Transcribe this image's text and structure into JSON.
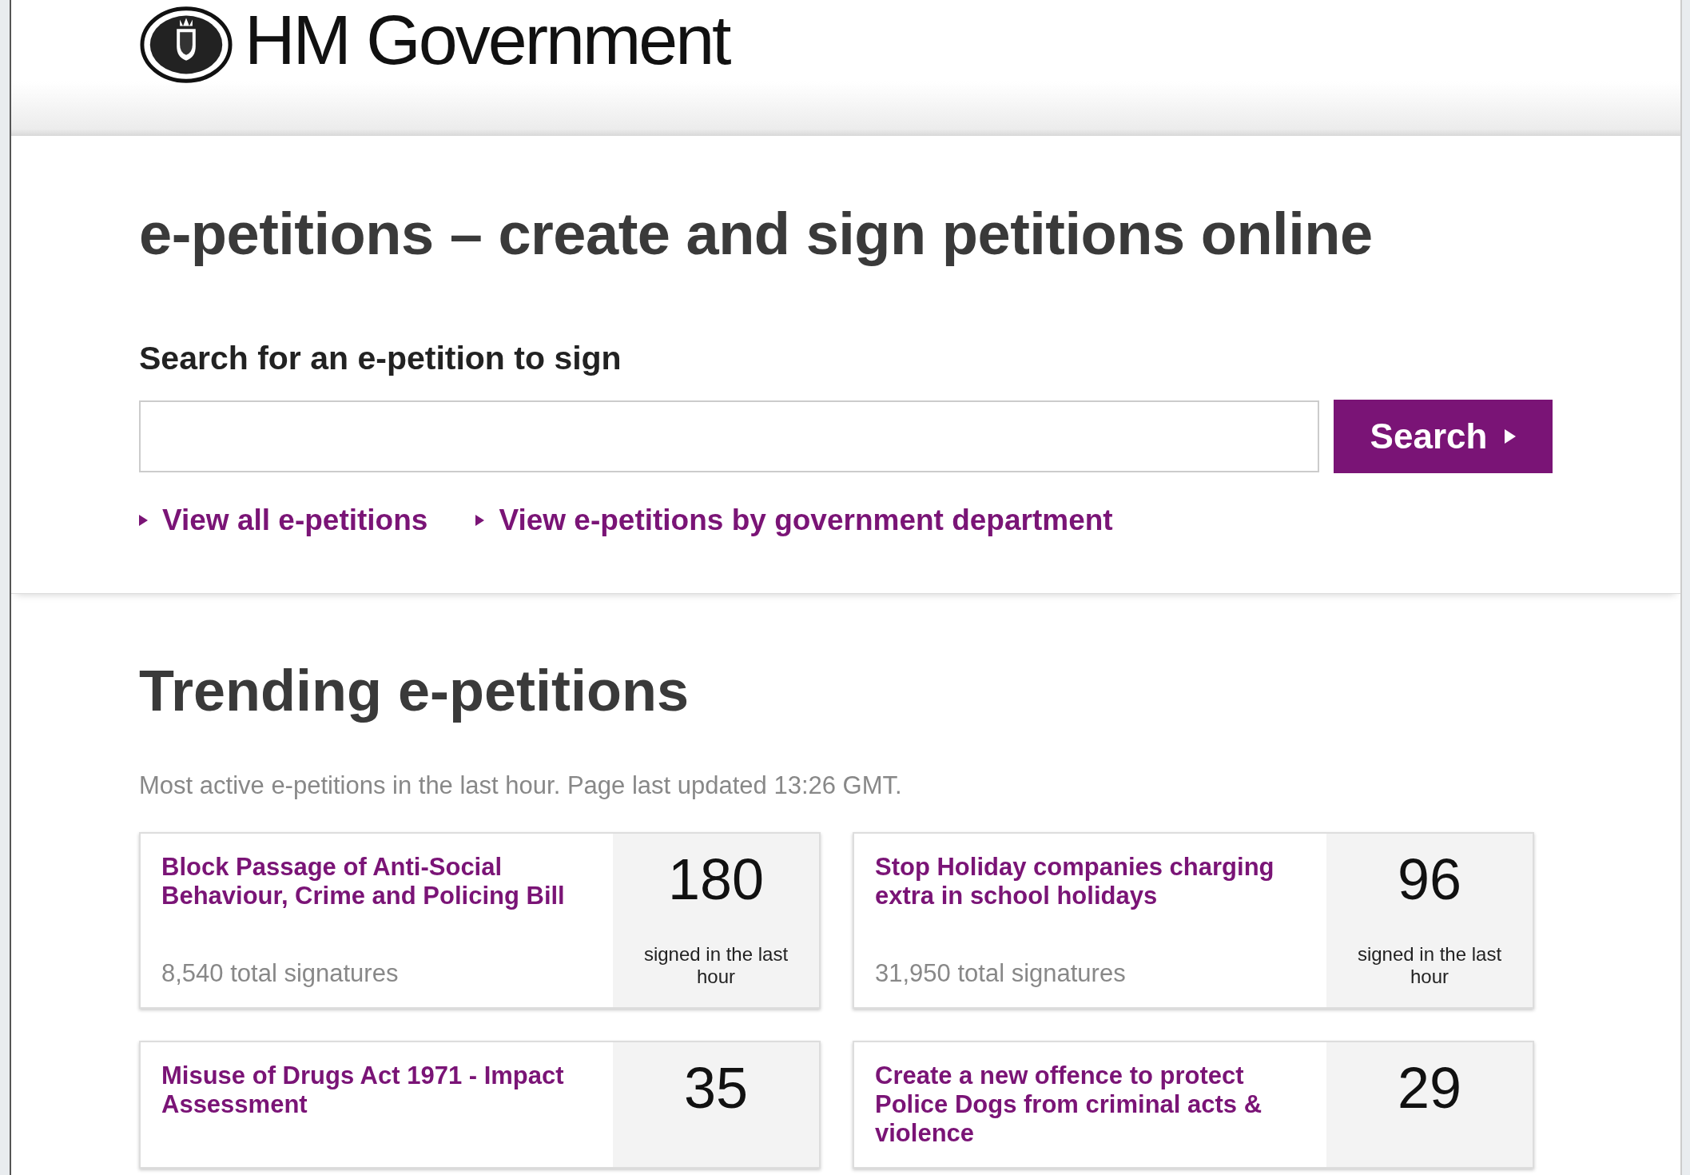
{
  "header": {
    "logo_text": "HM Government"
  },
  "title": "e-petitions – create and sign petitions online",
  "search": {
    "label": "Search for an e-petition to sign",
    "button": "Search"
  },
  "links": [
    "View all e-petitions",
    "View e-petitions by government department"
  ],
  "trending": {
    "title": "Trending e-petitions",
    "subtitle": "Most active e-petitions in the last hour. Page last updated 13:26 GMT.",
    "petitions": [
      {
        "title": "Block Passage of Anti-Social Behaviour, Crime and Policing Bill",
        "count": "180",
        "count_label": "signed in the last hour",
        "total": "8,540 total signatures"
      },
      {
        "title": "Stop Holiday companies charging extra in school holidays",
        "count": "96",
        "count_label": "signed in the last hour",
        "total": "31,950 total signatures"
      },
      {
        "title": "Misuse of Drugs Act 1971 - Impact Assessment",
        "count": "35"
      },
      {
        "title": "Create a new offence to protect Police Dogs from criminal acts & violence",
        "count": "29"
      }
    ]
  }
}
